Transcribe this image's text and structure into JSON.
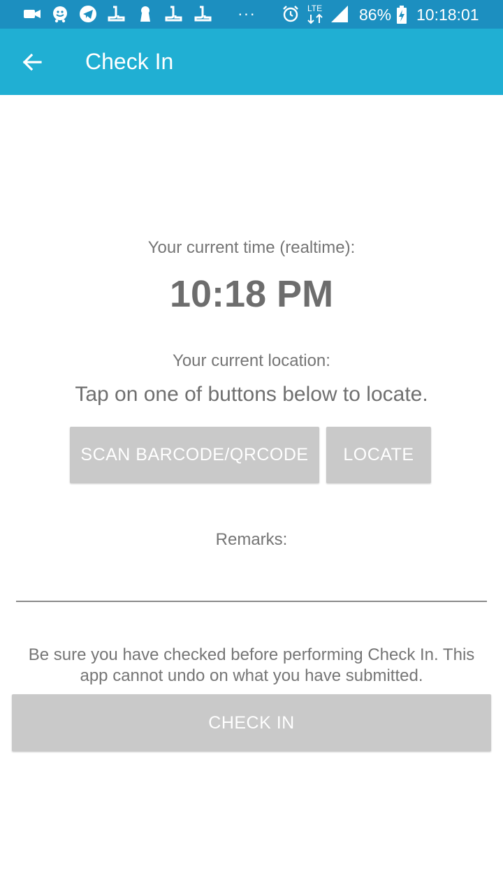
{
  "status_bar": {
    "icons_left": [
      "video-camera-icon",
      "waze-icon",
      "telegram-icon",
      "app-icon",
      "keyhole-icon",
      "app-icon",
      "app-icon",
      "more-notifications-icon"
    ],
    "icons_right": [
      "alarm-icon",
      "lte-signal-icon",
      "cell-signal-icon",
      "battery-charging-icon"
    ],
    "network_label": "LTE",
    "more_indicator": "···",
    "battery_percent": "86%",
    "clock": "10:18:01",
    "background_color": "#1c8fc0"
  },
  "app_bar": {
    "title": "Check In",
    "back_icon": "arrow-left-icon",
    "background_color": "#20afd3"
  },
  "main": {
    "time_label": "Your current time (realtime):",
    "time_value": "10:18 PM",
    "location_label": "Your current location:",
    "location_value": "Tap on one of buttons below to locate.",
    "scan_button_label": "SCAN BARCODE/QRCODE",
    "locate_button_label": "LOCATE",
    "remarks_label": "Remarks:",
    "remarks_value": "",
    "remarks_placeholder": "",
    "warning_text": "Be sure you have checked before performing Check In. This app cannot undo on what you have submitted.",
    "checkin_button_label": "CHECK IN",
    "button_color": "#c9c9c9"
  }
}
